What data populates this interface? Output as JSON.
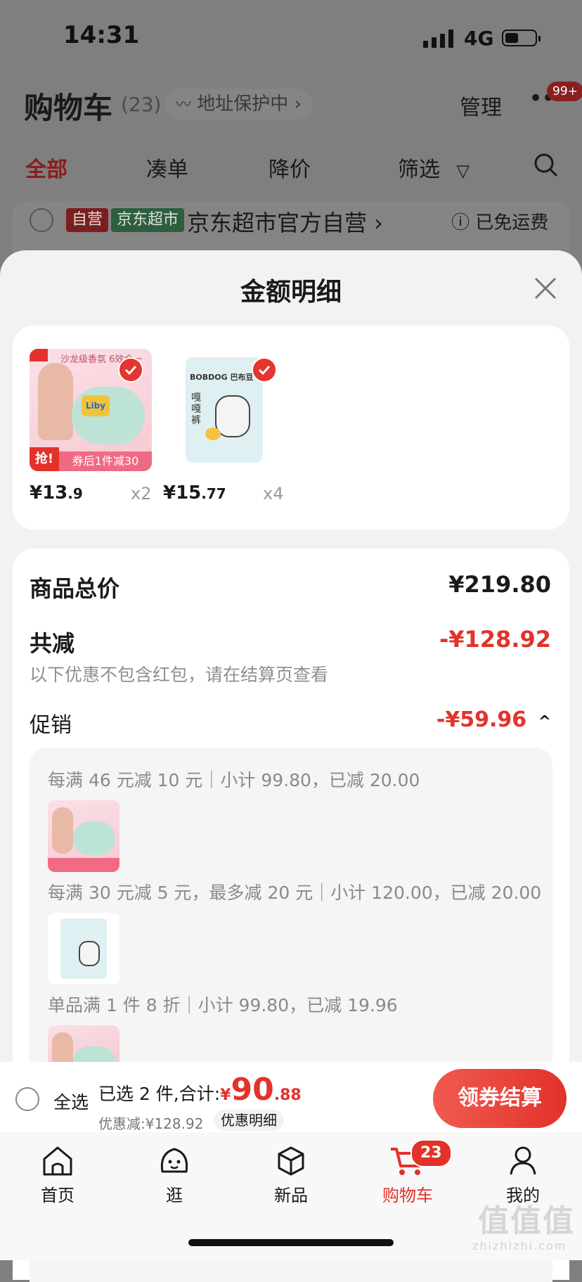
{
  "status_bar": {
    "time": "14:31",
    "network": "4G"
  },
  "header": {
    "title": "购物车",
    "count": "(23)",
    "address_protect": "地址保护中 ›",
    "manage": "管理",
    "more_badge": "99+"
  },
  "tabs": [
    "全部",
    "凑单",
    "降价",
    "筛选"
  ],
  "shop": {
    "tag_self": "自营",
    "tag_market": "京东超市",
    "name": "京东超市官方自营 ›",
    "shipping": "已免运费"
  },
  "sheet": {
    "title": "金额明细",
    "items": [
      {
        "name": "Liby",
        "promo_banner": "沙龙级香氛 6效合一",
        "grab": "抢!",
        "coupon": "券后1件减30",
        "price_main": "¥13",
        "price_dec": ".9",
        "qty": "x2"
      },
      {
        "name": "BOBDOG 巴布豆",
        "product_label": "嘎嘎裤",
        "price_main": "¥15",
        "price_dec": ".77",
        "qty": "x4"
      }
    ],
    "total_label": "商品总价",
    "total_value": "¥219.80",
    "discount_label": "共减",
    "discount_value": "-¥128.92",
    "discount_note": "以下优惠不包含红包，请在结算页查看",
    "promo_label": "促销",
    "promo_value": "-¥59.96",
    "promo_caret": "^",
    "rules": [
      "每满 46 元减 10 元｜小计 99.80，已减 20.00",
      "每满 30 元减 5 元，最多减 20 元｜小计 120.00，已减 20.00",
      "单品满 1 件 8 折｜小计 99.80，已减 19.96"
    ]
  },
  "checkout": {
    "select_all": "全选",
    "selected_prefix": "已选 2 件,合计:",
    "currency": "¥",
    "total_main": "90",
    "total_dec": ".88",
    "saved": "优惠减:¥128.92",
    "detail_link": "优惠明细",
    "settle_button": "领券结算"
  },
  "nav": {
    "items": [
      "首页",
      "逛",
      "新品",
      "购物车",
      "我的"
    ],
    "cart_badge": "23"
  },
  "watermark": {
    "text": "值值值",
    "site": "zhizhizhi.com"
  },
  "colors": {
    "accent": "#e2322a",
    "text": "#1a1a1a",
    "muted": "#8f8f8f"
  }
}
